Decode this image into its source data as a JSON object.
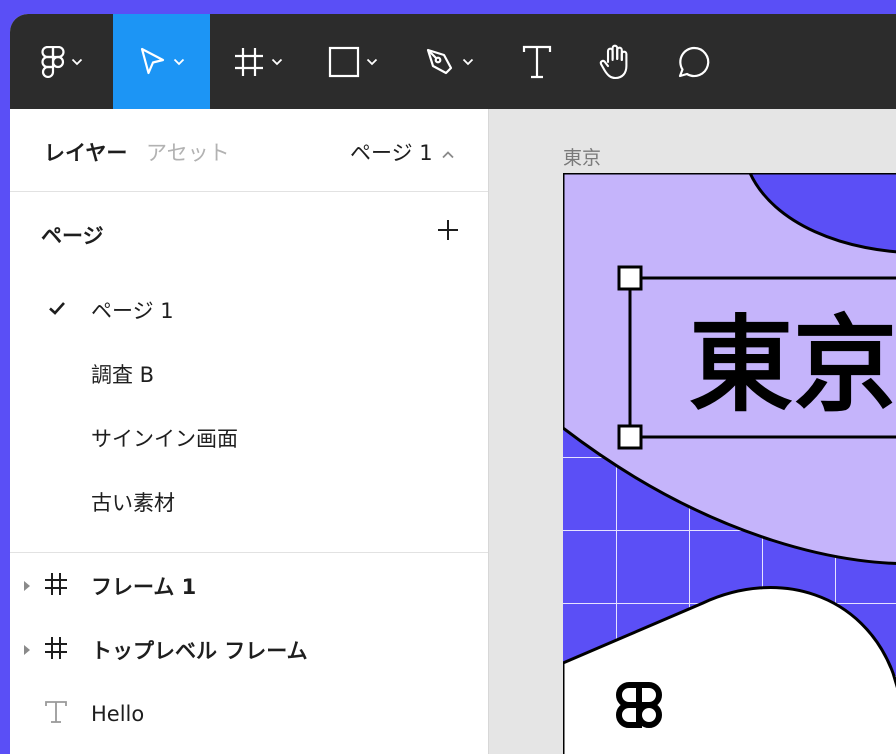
{
  "toolbar": {
    "tools": [
      {
        "name": "main-menu",
        "icon": "figma-logo-icon",
        "has_dropdown": true
      },
      {
        "name": "move",
        "icon": "move-cursor-icon",
        "has_dropdown": true,
        "active": true
      },
      {
        "name": "frame",
        "icon": "frame-icon",
        "has_dropdown": true
      },
      {
        "name": "shape",
        "icon": "rectangle-icon",
        "has_dropdown": true
      },
      {
        "name": "pen",
        "icon": "pen-icon",
        "has_dropdown": true
      },
      {
        "name": "text",
        "icon": "text-icon",
        "has_dropdown": false
      },
      {
        "name": "hand",
        "icon": "hand-icon",
        "has_dropdown": false
      },
      {
        "name": "comment",
        "icon": "comment-icon",
        "has_dropdown": false
      }
    ],
    "colors": {
      "bar": "#2c2c2c",
      "active": "#1c95f5"
    }
  },
  "panel": {
    "tab_layers": "レイヤー",
    "tab_assets": "アセット",
    "current_page": "ページ 1",
    "pages_heading": "ページ",
    "pages": [
      {
        "label": "ページ 1",
        "current": true
      },
      {
        "label": "調査 B",
        "current": false
      },
      {
        "label": "サインイン画面",
        "current": false
      },
      {
        "label": "古い素材",
        "current": false
      }
    ],
    "layers": [
      {
        "label": "フレーム 1",
        "type": "frame",
        "expandable": true
      },
      {
        "label": "トップレベル フレーム",
        "type": "frame",
        "expandable": true
      },
      {
        "label": "Hello",
        "type": "text",
        "expandable": false
      }
    ]
  },
  "canvas": {
    "frame_label": "東京",
    "headline_text": "東京",
    "colors": {
      "background": "#e5e5e5",
      "lavender": "#c5b4fb",
      "indigo": "#5b4ff6"
    }
  }
}
